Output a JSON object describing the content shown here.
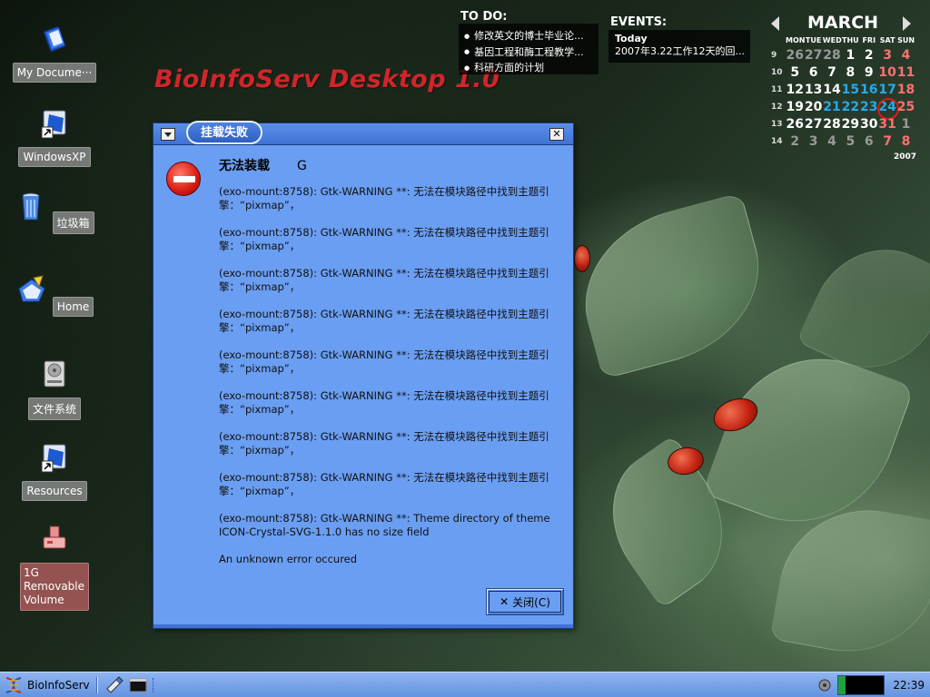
{
  "desktop": {
    "brand_title": "BioInfoServ Desktop 1.0",
    "icons": [
      {
        "label": "My Docume···",
        "icon": "documents-icon"
      },
      {
        "label": "WindowsXP",
        "icon": "shortcut-icon"
      },
      {
        "label": "垃圾箱",
        "icon": "trash-icon"
      },
      {
        "label": "Home",
        "icon": "home-folder-icon"
      },
      {
        "label": "文件系统",
        "icon": "harddisk-icon"
      },
      {
        "label": "Resources",
        "icon": "shortcut-icon"
      },
      {
        "label": "1G Removable Volume",
        "icon": "usb-drive-icon"
      }
    ]
  },
  "todo": {
    "title": "TO DO:",
    "items": [
      "修改英文的博士毕业论...",
      "基因工程和酶工程教学...",
      "科研方面的计划"
    ]
  },
  "events": {
    "title": "EVENTS:",
    "heading": "Today",
    "item": "2007年3.22工作12天的回..."
  },
  "calendar": {
    "month": "MARCH",
    "year": "2007",
    "dow": [
      "MON",
      "TUE",
      "WED",
      "THU",
      "FRI",
      "SAT",
      "SUN"
    ],
    "weeks": [
      {
        "wk": "9",
        "days": [
          [
            "26",
            "dim"
          ],
          [
            "27",
            "dim"
          ],
          [
            "28",
            "dim"
          ],
          [
            "1",
            ""
          ],
          [
            "2",
            ""
          ],
          [
            "3",
            "red"
          ],
          [
            "4",
            "red"
          ]
        ]
      },
      {
        "wk": "10",
        "days": [
          [
            "5",
            ""
          ],
          [
            "6",
            ""
          ],
          [
            "7",
            ""
          ],
          [
            "8",
            ""
          ],
          [
            "9",
            ""
          ],
          [
            "10",
            "red"
          ],
          [
            "11",
            "red"
          ]
        ]
      },
      {
        "wk": "11",
        "days": [
          [
            "12",
            ""
          ],
          [
            "13",
            ""
          ],
          [
            "14",
            ""
          ],
          [
            "15",
            "blue"
          ],
          [
            "16",
            "blue"
          ],
          [
            "17",
            "blue"
          ],
          [
            "18",
            "red"
          ]
        ]
      },
      {
        "wk": "12",
        "days": [
          [
            "19",
            ""
          ],
          [
            "20",
            ""
          ],
          [
            "21",
            "blue"
          ],
          [
            "22",
            "blue"
          ],
          [
            "23",
            "blue"
          ],
          [
            "24",
            "blue today"
          ],
          [
            "25",
            "red"
          ]
        ]
      },
      {
        "wk": "13",
        "days": [
          [
            "26",
            ""
          ],
          [
            "27",
            ""
          ],
          [
            "28",
            ""
          ],
          [
            "29",
            ""
          ],
          [
            "30",
            ""
          ],
          [
            "31",
            "red"
          ],
          [
            "1",
            "dim"
          ]
        ]
      },
      {
        "wk": "14",
        "days": [
          [
            "2",
            "dim"
          ],
          [
            "3",
            "dim"
          ],
          [
            "4",
            "dim"
          ],
          [
            "5",
            "dim"
          ],
          [
            "6",
            "dim"
          ],
          [
            "7",
            "dim red"
          ],
          [
            "8",
            "dim red"
          ]
        ]
      }
    ],
    "colors": {
      "accent_blue": "#29a8e8",
      "weekend_red": "#ff7070",
      "today_ring": "#e01818"
    }
  },
  "dialog": {
    "title": "挂载失败",
    "heading": "无法装载",
    "heading_extra": "G",
    "messages": [
      "(exo-mount:8758): Gtk-WARNING **: 无法在模块路径中找到主题引擎：“pixmap”，",
      "(exo-mount:8758): Gtk-WARNING **: 无法在模块路径中找到主题引擎：“pixmap”，",
      "(exo-mount:8758): Gtk-WARNING **: 无法在模块路径中找到主题引擎：“pixmap”，",
      "(exo-mount:8758): Gtk-WARNING **: 无法在模块路径中找到主题引擎：“pixmap”，",
      "(exo-mount:8758): Gtk-WARNING **: 无法在模块路径中找到主题引擎：“pixmap”，",
      "(exo-mount:8758): Gtk-WARNING **: 无法在模块路径中找到主题引擎：“pixmap”，",
      "(exo-mount:8758): Gtk-WARNING **: 无法在模块路径中找到主题引擎：“pixmap”，",
      "(exo-mount:8758): Gtk-WARNING **: 无法在模块路径中找到主题引擎：“pixmap”，",
      "(exo-mount:8758): Gtk-WARNING **: Theme directory  of theme ICON-Crystal-SVG-1.1.0 has no size field"
    ],
    "footer_message": "An unknown error occured",
    "close_button_label": "关闭(C)",
    "colors": {
      "background": "#6a9ef2",
      "titlebar": "#3f72d4"
    }
  },
  "taskbar": {
    "start_label": "BioInfoServ",
    "clock": "22:39"
  }
}
